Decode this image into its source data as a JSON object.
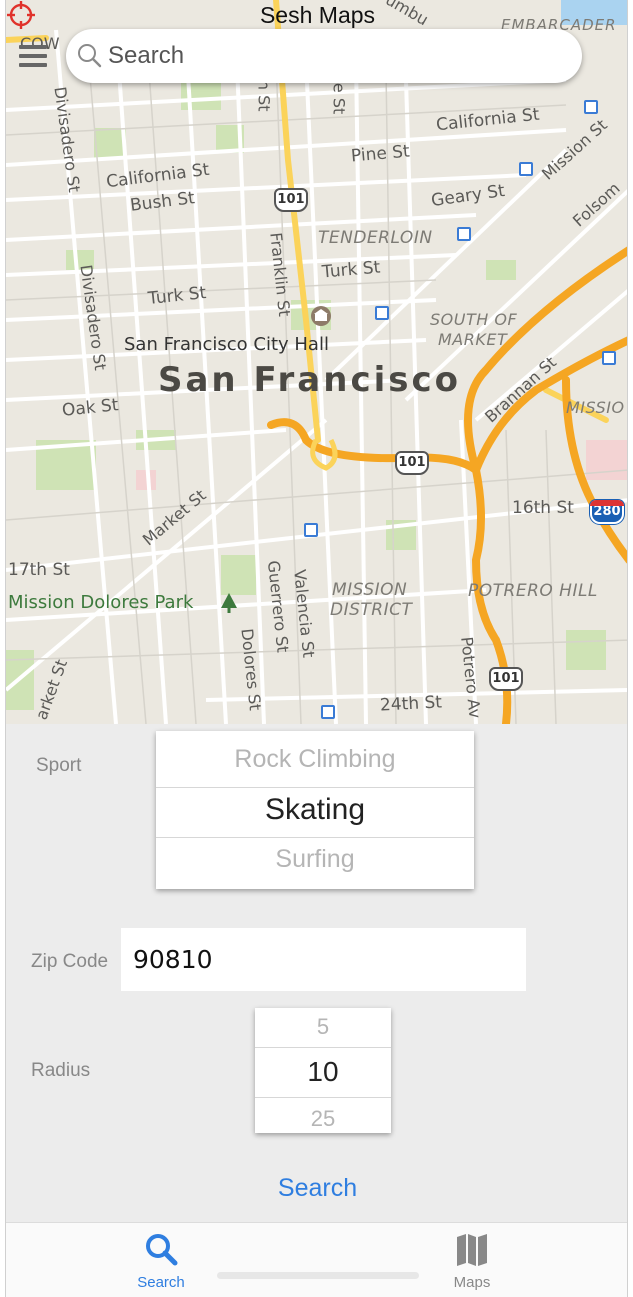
{
  "app": {
    "title": "Sesh Maps"
  },
  "search": {
    "placeholder": "Search"
  },
  "map": {
    "labels": {
      "california_st_w": "California St",
      "california_st_e": "California St",
      "bush_st": "Bush St",
      "pine_st": "Pine St",
      "geary_st": "Geary St",
      "tenderloin": "TENDERLOIN",
      "turk_st_e": "Turk St",
      "turk_st_w": "Turk St",
      "franklin_st": "Franklin St",
      "divisadero_top": "Divisadero St",
      "divisadero_mid": "Divisadero St",
      "city_hall": "San Francisco City Hall",
      "san_francisco": "San Francisco",
      "oak_st": "Oak St",
      "south_of_market_1": "SOUTH OF",
      "south_of_market_2": "MARKET",
      "brannan_st": "Brannan St",
      "mission_bay": "MISSIO",
      "mission_st": "Mission St",
      "folsom": "Folsom",
      "embarcadero": "EMBARCADER",
      "de_st": "de St",
      "in_st": "in St",
      "market_st": "Market St",
      "st_16": "16th St",
      "st_17": "17th St",
      "mission_dolores": "Mission Dolores Park",
      "guerrero": "Guerrero St",
      "valencia": "Valencia St",
      "dolores": "Dolores St",
      "mission_district_1": "MISSION",
      "mission_district_2": "DISTRICT",
      "potrero_hill": "POTRERO HILL",
      "potrero_av": "Potrero Av",
      "st_24": "24th St",
      "arket_st": "arket St",
      "cow": "COW",
      "mbu": "umbu"
    },
    "shields": {
      "us101_a": "101",
      "us101_b": "101",
      "us101_c": "101",
      "i280": "280"
    }
  },
  "form": {
    "sport": {
      "label": "Sport",
      "options": [
        "Rock Climbing",
        "Skating",
        "Surfing"
      ],
      "selected": "Skating"
    },
    "zip": {
      "label": "Zip Code",
      "value": "90810"
    },
    "radius": {
      "label": "Radius",
      "options": [
        "5",
        "10",
        "25"
      ],
      "selected": "10"
    },
    "search_label": "Search"
  },
  "tabbar": {
    "tabs": [
      {
        "label": "Search",
        "icon": "search-icon",
        "active": true
      },
      {
        "label": "Maps",
        "icon": "map-icon",
        "active": false
      }
    ]
  },
  "colors": {
    "accent": "#2f7ee0",
    "highway": "#f5a623",
    "locate": "#e0322b"
  }
}
